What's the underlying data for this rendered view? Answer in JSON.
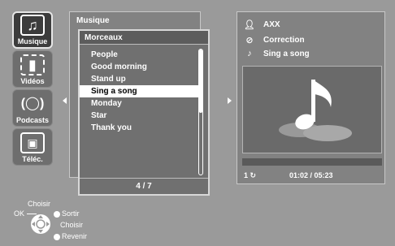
{
  "categories": [
    {
      "label": "Musique",
      "icon": "music-note-icon",
      "active": true
    },
    {
      "label": "Vidéos",
      "icon": "film-icon",
      "active": false
    },
    {
      "label": "Podcasts",
      "icon": "podcast-icon",
      "active": false
    },
    {
      "label": "Téléc.",
      "icon": "download-device-icon",
      "active": false
    }
  ],
  "back_panel": {
    "title": "Musique"
  },
  "list_panel": {
    "title": "Morceaux",
    "items": [
      "People",
      "Good morning",
      "Stand up",
      "Sing a song",
      "Monday",
      "Star",
      "Thank you"
    ],
    "selected_index": 3,
    "page": "4 / 7"
  },
  "now_playing": {
    "artist": "AXX",
    "album": "Correction",
    "track": "Sing a song",
    "repeat": "1",
    "time": "01:02 / 05:23",
    "progress_fraction": 0.19
  },
  "controls": {
    "ok": "OK",
    "choose_top": "Choisir",
    "exit": "Sortir",
    "choose_bottom": "Choisir",
    "back": "Revenir"
  },
  "colors": {
    "background": "#9a9a9a",
    "selection": "#ffffff",
    "panel": "#707070"
  }
}
